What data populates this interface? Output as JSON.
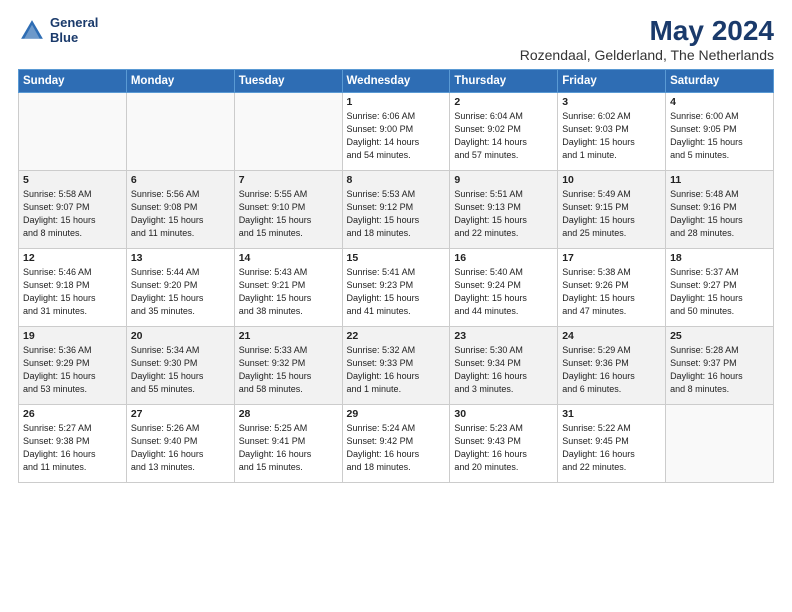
{
  "header": {
    "logo_line1": "General",
    "logo_line2": "Blue",
    "main_title": "May 2024",
    "sub_title": "Rozendaal, Gelderland, The Netherlands"
  },
  "days_of_week": [
    "Sunday",
    "Monday",
    "Tuesday",
    "Wednesday",
    "Thursday",
    "Friday",
    "Saturday"
  ],
  "weeks": [
    [
      {
        "day": "",
        "lines": []
      },
      {
        "day": "",
        "lines": []
      },
      {
        "day": "",
        "lines": []
      },
      {
        "day": "1",
        "lines": [
          "Sunrise: 6:06 AM",
          "Sunset: 9:00 PM",
          "Daylight: 14 hours",
          "and 54 minutes."
        ]
      },
      {
        "day": "2",
        "lines": [
          "Sunrise: 6:04 AM",
          "Sunset: 9:02 PM",
          "Daylight: 14 hours",
          "and 57 minutes."
        ]
      },
      {
        "day": "3",
        "lines": [
          "Sunrise: 6:02 AM",
          "Sunset: 9:03 PM",
          "Daylight: 15 hours",
          "and 1 minute."
        ]
      },
      {
        "day": "4",
        "lines": [
          "Sunrise: 6:00 AM",
          "Sunset: 9:05 PM",
          "Daylight: 15 hours",
          "and 5 minutes."
        ]
      }
    ],
    [
      {
        "day": "5",
        "lines": [
          "Sunrise: 5:58 AM",
          "Sunset: 9:07 PM",
          "Daylight: 15 hours",
          "and 8 minutes."
        ]
      },
      {
        "day": "6",
        "lines": [
          "Sunrise: 5:56 AM",
          "Sunset: 9:08 PM",
          "Daylight: 15 hours",
          "and 11 minutes."
        ]
      },
      {
        "day": "7",
        "lines": [
          "Sunrise: 5:55 AM",
          "Sunset: 9:10 PM",
          "Daylight: 15 hours",
          "and 15 minutes."
        ]
      },
      {
        "day": "8",
        "lines": [
          "Sunrise: 5:53 AM",
          "Sunset: 9:12 PM",
          "Daylight: 15 hours",
          "and 18 minutes."
        ]
      },
      {
        "day": "9",
        "lines": [
          "Sunrise: 5:51 AM",
          "Sunset: 9:13 PM",
          "Daylight: 15 hours",
          "and 22 minutes."
        ]
      },
      {
        "day": "10",
        "lines": [
          "Sunrise: 5:49 AM",
          "Sunset: 9:15 PM",
          "Daylight: 15 hours",
          "and 25 minutes."
        ]
      },
      {
        "day": "11",
        "lines": [
          "Sunrise: 5:48 AM",
          "Sunset: 9:16 PM",
          "Daylight: 15 hours",
          "and 28 minutes."
        ]
      }
    ],
    [
      {
        "day": "12",
        "lines": [
          "Sunrise: 5:46 AM",
          "Sunset: 9:18 PM",
          "Daylight: 15 hours",
          "and 31 minutes."
        ]
      },
      {
        "day": "13",
        "lines": [
          "Sunrise: 5:44 AM",
          "Sunset: 9:20 PM",
          "Daylight: 15 hours",
          "and 35 minutes."
        ]
      },
      {
        "day": "14",
        "lines": [
          "Sunrise: 5:43 AM",
          "Sunset: 9:21 PM",
          "Daylight: 15 hours",
          "and 38 minutes."
        ]
      },
      {
        "day": "15",
        "lines": [
          "Sunrise: 5:41 AM",
          "Sunset: 9:23 PM",
          "Daylight: 15 hours",
          "and 41 minutes."
        ]
      },
      {
        "day": "16",
        "lines": [
          "Sunrise: 5:40 AM",
          "Sunset: 9:24 PM",
          "Daylight: 15 hours",
          "and 44 minutes."
        ]
      },
      {
        "day": "17",
        "lines": [
          "Sunrise: 5:38 AM",
          "Sunset: 9:26 PM",
          "Daylight: 15 hours",
          "and 47 minutes."
        ]
      },
      {
        "day": "18",
        "lines": [
          "Sunrise: 5:37 AM",
          "Sunset: 9:27 PM",
          "Daylight: 15 hours",
          "and 50 minutes."
        ]
      }
    ],
    [
      {
        "day": "19",
        "lines": [
          "Sunrise: 5:36 AM",
          "Sunset: 9:29 PM",
          "Daylight: 15 hours",
          "and 53 minutes."
        ]
      },
      {
        "day": "20",
        "lines": [
          "Sunrise: 5:34 AM",
          "Sunset: 9:30 PM",
          "Daylight: 15 hours",
          "and 55 minutes."
        ]
      },
      {
        "day": "21",
        "lines": [
          "Sunrise: 5:33 AM",
          "Sunset: 9:32 PM",
          "Daylight: 15 hours",
          "and 58 minutes."
        ]
      },
      {
        "day": "22",
        "lines": [
          "Sunrise: 5:32 AM",
          "Sunset: 9:33 PM",
          "Daylight: 16 hours",
          "and 1 minute."
        ]
      },
      {
        "day": "23",
        "lines": [
          "Sunrise: 5:30 AM",
          "Sunset: 9:34 PM",
          "Daylight: 16 hours",
          "and 3 minutes."
        ]
      },
      {
        "day": "24",
        "lines": [
          "Sunrise: 5:29 AM",
          "Sunset: 9:36 PM",
          "Daylight: 16 hours",
          "and 6 minutes."
        ]
      },
      {
        "day": "25",
        "lines": [
          "Sunrise: 5:28 AM",
          "Sunset: 9:37 PM",
          "Daylight: 16 hours",
          "and 8 minutes."
        ]
      }
    ],
    [
      {
        "day": "26",
        "lines": [
          "Sunrise: 5:27 AM",
          "Sunset: 9:38 PM",
          "Daylight: 16 hours",
          "and 11 minutes."
        ]
      },
      {
        "day": "27",
        "lines": [
          "Sunrise: 5:26 AM",
          "Sunset: 9:40 PM",
          "Daylight: 16 hours",
          "and 13 minutes."
        ]
      },
      {
        "day": "28",
        "lines": [
          "Sunrise: 5:25 AM",
          "Sunset: 9:41 PM",
          "Daylight: 16 hours",
          "and 15 minutes."
        ]
      },
      {
        "day": "29",
        "lines": [
          "Sunrise: 5:24 AM",
          "Sunset: 9:42 PM",
          "Daylight: 16 hours",
          "and 18 minutes."
        ]
      },
      {
        "day": "30",
        "lines": [
          "Sunrise: 5:23 AM",
          "Sunset: 9:43 PM",
          "Daylight: 16 hours",
          "and 20 minutes."
        ]
      },
      {
        "day": "31",
        "lines": [
          "Sunrise: 5:22 AM",
          "Sunset: 9:45 PM",
          "Daylight: 16 hours",
          "and 22 minutes."
        ]
      },
      {
        "day": "",
        "lines": []
      }
    ]
  ]
}
